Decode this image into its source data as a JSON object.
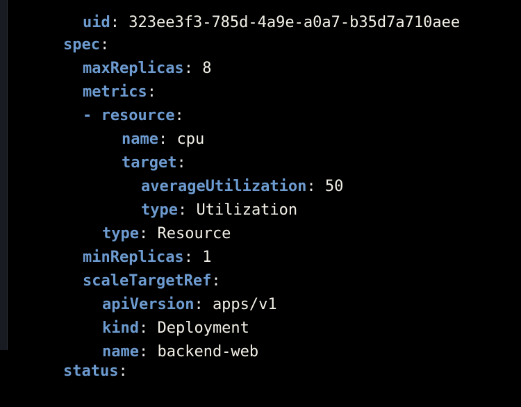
{
  "editor": {
    "lines": [
      {
        "key": "uid",
        "value": "323ee3f3-785d-4a9e-a0a7-b35d7a710aee"
      },
      {
        "key": "spec",
        "value": ""
      },
      {
        "key": "maxReplicas",
        "value": "8"
      },
      {
        "key": "metrics",
        "value": ""
      },
      {
        "dash": "-",
        "key": "resource",
        "value": ""
      },
      {
        "key": "name",
        "value": "cpu"
      },
      {
        "key": "target",
        "value": ""
      },
      {
        "key": "averageUtilization",
        "value": "50"
      },
      {
        "key": "type",
        "value": "Utilization"
      },
      {
        "key": "type",
        "value": "Resource"
      },
      {
        "key": "minReplicas",
        "value": "1"
      },
      {
        "key": "scaleTargetRef",
        "value": ""
      },
      {
        "key": "apiVersion",
        "value": "apps/v1"
      },
      {
        "key": "kind",
        "value": "Deployment"
      },
      {
        "key": "name",
        "value": "backend-web"
      },
      {
        "key": "status",
        "value": ""
      }
    ]
  },
  "colors": {
    "background": "#000000",
    "key": "#6d9bd0",
    "value": "#f2efe6"
  }
}
